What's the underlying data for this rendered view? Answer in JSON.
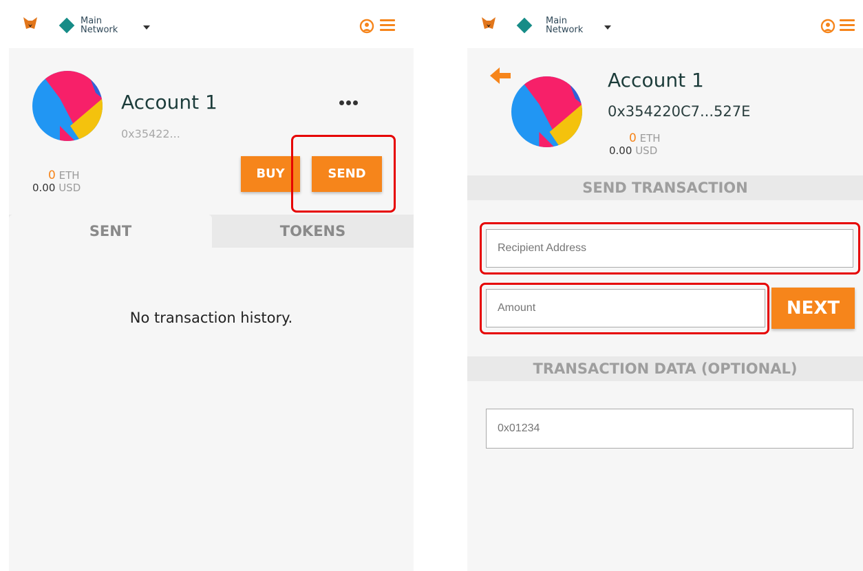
{
  "network": {
    "line1": "Main",
    "line2": "Network"
  },
  "wallet": {
    "account_name": "Account 1",
    "address_short": "0x35422...",
    "address_full": "0x354220C7...527E",
    "balance_eth_value": "0",
    "balance_eth_unit": "ETH",
    "balance_usd_value": "0.00",
    "balance_usd_unit": "USD"
  },
  "left": {
    "buy_label": "BUY",
    "send_label": "SEND",
    "tabs": [
      {
        "label": "SENT",
        "active": true
      },
      {
        "label": "TOKENS",
        "active": false
      }
    ],
    "empty_message": "No transaction history."
  },
  "right": {
    "send_header": "SEND TRANSACTION",
    "recipient_placeholder": "Recipient Address",
    "amount_placeholder": "Amount",
    "next_label": "NEXT",
    "data_header": "TRANSACTION DATA (OPTIONAL)",
    "data_placeholder": "0x01234"
  },
  "colors": {
    "accent": "#f6851b",
    "teal": "#168c87",
    "highlight": "#e60000"
  },
  "icons": [
    "metamask-fox-icon",
    "network-diamond-icon",
    "chevron-down-icon",
    "account-switch-icon",
    "menu-icon",
    "more-dots-icon",
    "back-arrow-icon",
    "identicon-avatar"
  ]
}
